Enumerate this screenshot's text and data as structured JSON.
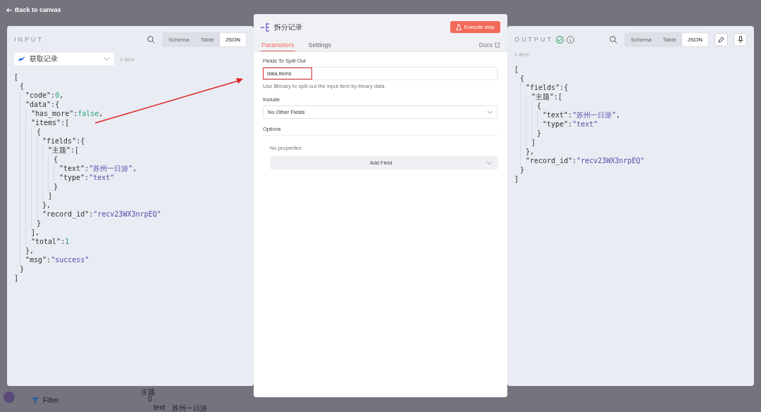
{
  "back_link": "Back to canvas",
  "input": {
    "title": "INPUT",
    "views": [
      {
        "label": "Schema",
        "selected": false
      },
      {
        "label": "Table",
        "selected": false
      },
      {
        "label": "JSON",
        "selected": true
      }
    ],
    "source": "获取记录",
    "count": "1 item",
    "json": {
      "open": "[",
      "close": "]",
      "children": [
        {
          "open": "{",
          "close": "}",
          "children": [
            {
              "key": "\"code\":",
              "value": "0",
              "kind": "number",
              "punct": ","
            },
            {
              "key": "\"data\":",
              "open": "{",
              "close": "},",
              "children": [
                {
                  "key": "\"has_more\":",
                  "value": "false",
                  "kind": "number",
                  "punct": ","
                },
                {
                  "key": "\"items\":",
                  "open": "[",
                  "close": "],",
                  "children": [
                    {
                      "open": "{",
                      "close": "}",
                      "children": [
                        {
                          "key": "\"fields\":",
                          "open": "{",
                          "close": "},",
                          "children": [
                            {
                              "key": "\"主题\":",
                              "open": "[",
                              "close": "]",
                              "children": [
                                {
                                  "open": "{",
                                  "close": "}",
                                  "children": [
                                    {
                                      "key": "\"text\":",
                                      "value": "\"苏州一日游\"",
                                      "kind": "string",
                                      "punct": ","
                                    },
                                    {
                                      "key": "\"type\":",
                                      "value": "\"text\"",
                                      "kind": "string"
                                    }
                                  ]
                                }
                              ]
                            }
                          ]
                        },
                        {
                          "key": "\"record_id\":",
                          "value": "\"recv23WX3nrpEQ\"",
                          "kind": "string"
                        }
                      ]
                    }
                  ]
                },
                {
                  "key": "\"total\":",
                  "value": "1",
                  "kind": "number"
                }
              ]
            },
            {
              "key": "\"msg\":",
              "value": "\"success\"",
              "kind": "string"
            }
          ]
        }
      ]
    }
  },
  "node": {
    "title": "拆分记录",
    "execute": "Execute step",
    "tabs": [
      {
        "label": "Parameters",
        "selected": true
      },
      {
        "label": "Settings",
        "selected": false
      }
    ],
    "docs": "Docs",
    "fields_label": "Fields To Split Out",
    "fields_value": "data.items",
    "hint": "Use $binary to split out the input item by binary data",
    "include_label": "Include",
    "include_value": "No Other Fields",
    "options_label": "Options",
    "no_properties": "No properties",
    "add_field": "Add Field"
  },
  "output": {
    "title": "OUTPUT",
    "views": [
      {
        "label": "Schema",
        "selected": false
      },
      {
        "label": "Table",
        "selected": false
      },
      {
        "label": "JSON",
        "selected": true
      }
    ],
    "count": "1 item",
    "json": {
      "open": "[",
      "close": "]",
      "children": [
        {
          "open": "{",
          "close": "}",
          "children": [
            {
              "key": "\"fields\":",
              "open": "{",
              "close": "},",
              "children": [
                {
                  "key": "\"主题\":",
                  "open": "[",
                  "close": "]",
                  "children": [
                    {
                      "open": "{",
                      "close": "}",
                      "children": [
                        {
                          "key": "\"text\":",
                          "value": "\"苏州一日游\"",
                          "kind": "string",
                          "punct": ","
                        },
                        {
                          "key": "\"type\":",
                          "value": "\"text\"",
                          "kind": "string"
                        }
                      ]
                    }
                  ]
                }
              ]
            },
            {
              "key": "\"record_id\":",
              "value": "\"recv23WX3nrpEQ\"",
              "kind": "string"
            }
          ]
        }
      ]
    }
  },
  "background": {
    "filter": "Filter",
    "column": "主题",
    "index": "0",
    "field": "text",
    "value": "苏州一日游"
  }
}
